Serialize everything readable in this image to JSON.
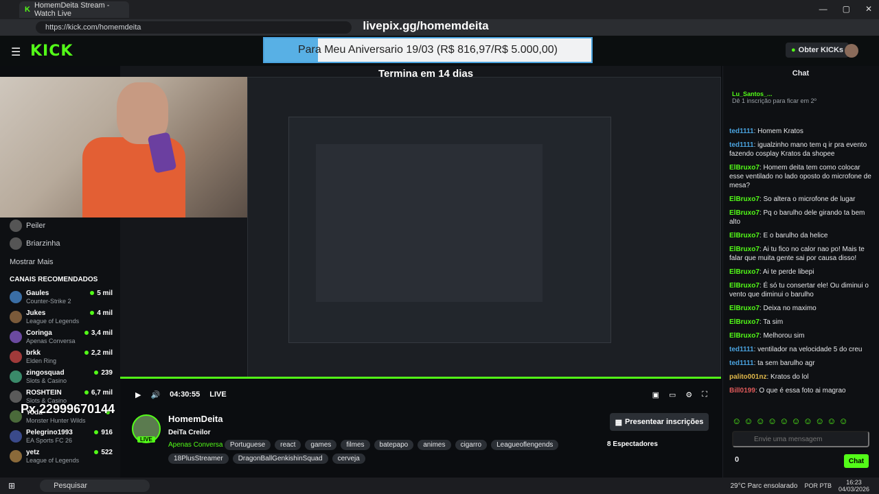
{
  "browser": {
    "tab_title": "HomemDeita Stream - Watch Live",
    "url": "https://kick.com/homemdeita",
    "window_controls": [
      "—",
      "▢",
      "✕"
    ]
  },
  "overlay": {
    "livepix_url": "livepix.gg/homemdeita",
    "goal_text": "Para Meu Aniversario 19/03 (R$ 816,97/R$ 5.000,00)",
    "goal_progress_pct": 16.3,
    "ends_in": "Termina em 14 dias",
    "pix_key": "Px 22999670144"
  },
  "header": {
    "logo": "KICK",
    "kicks_button": "Obter KICKs"
  },
  "sidebar": {
    "users": [
      "Peiler",
      "Briarzinha"
    ],
    "show_more": "Mostrar Mais",
    "recommended_title": "CANAIS RECOMENDADOS",
    "recommended": [
      {
        "name": "Gaules",
        "game": "Counter-Strike 2",
        "viewers": "5 mil",
        "color": "#3a6ea5"
      },
      {
        "name": "Jukes",
        "game": "League of Legends",
        "viewers": "4 mil",
        "color": "#7a5a3a"
      },
      {
        "name": "Coringa",
        "game": "Apenas Conversa",
        "viewers": "3,4 mil",
        "color": "#6b4aa0"
      },
      {
        "name": "brkk",
        "game": "Elden Ring",
        "viewers": "2,2 mil",
        "color": "#a03a3a"
      },
      {
        "name": "zingosquad",
        "game": "Slots & Casino",
        "viewers": "239",
        "color": "#3a8a6a"
      },
      {
        "name": "ROSHTEIN",
        "game": "Slots & Casino",
        "viewers": "6,7 mil",
        "color": "#5a5a5a"
      },
      {
        "name": "Yoda",
        "game": "Monster Hunter Wilds",
        "viewers": "",
        "color": "#4a6a3a"
      },
      {
        "name": "Pelegrino1993",
        "game": "EA Sports FC 26",
        "viewers": "916",
        "color": "#3a4a8a"
      },
      {
        "name": "yetz",
        "game": "League of Legends",
        "viewers": "522",
        "color": "#8a6a3a"
      }
    ]
  },
  "player": {
    "time": "04:30:55",
    "live_label": "LIVE"
  },
  "stream": {
    "streamer": "HomemDeita",
    "live_badge": "LIVE",
    "title": "DeiTa Creilor",
    "category": "Apenas Conversa",
    "tags": [
      "Portuguese",
      "react",
      "games",
      "filmes",
      "batepapo",
      "animes",
      "cigarro",
      "Leagueoflengends"
    ],
    "tags2": [
      "18PlusStreamer",
      "DragonBallGenkishinSquad",
      "cerveja"
    ],
    "subscribe_button": "Presentear inscrições",
    "viewers": "8 Espectadores"
  },
  "chat": {
    "title": "Chat",
    "pinned_user": "Lu_Santos_...",
    "pinned_text": "Dê 1 inscrição para ficar em 2º",
    "messages": [
      {
        "user": "ted1111",
        "text": "Homem Kratos",
        "color": "#4aa3df"
      },
      {
        "user": "ted1111",
        "text": "igualzinho mano tem q ir pra evento fazendo cosplay Kratos da shopee",
        "color": "#4aa3df"
      },
      {
        "user": "ElBruxo7",
        "text": "Homem deita tem como colocar esse ventilado no lado oposto do microfone de mesa?",
        "color": "#53fc18"
      },
      {
        "user": "ElBruxo7",
        "text": "So altera o microfone de lugar",
        "color": "#53fc18"
      },
      {
        "user": "ElBruxo7",
        "text": "Pq o barulho dele girando ta bem alto",
        "color": "#53fc18"
      },
      {
        "user": "ElBruxo7",
        "text": "E o barulho da helice",
        "color": "#53fc18"
      },
      {
        "user": "ElBruxo7",
        "text": "Ai tu fico no calor nao po! Mais te falar que muita gente sai por causa disso!",
        "color": "#53fc18"
      },
      {
        "user": "ElBruxo7",
        "text": "Ai te perde libepi",
        "color": "#53fc18"
      },
      {
        "user": "ElBruxo7",
        "text": "É só tu consertar ele! Ou diminui o vento que diminui o barulho",
        "color": "#53fc18"
      },
      {
        "user": "ElBruxo7",
        "text": "Deixa no maximo",
        "color": "#53fc18"
      },
      {
        "user": "ElBruxo7",
        "text": "Ta sim",
        "color": "#53fc18"
      },
      {
        "user": "ElBruxo7",
        "text": "Melhorou sim",
        "color": "#53fc18"
      },
      {
        "user": "ted1111",
        "text": "ventilador na velocidade 5 do creu",
        "color": "#4aa3df"
      },
      {
        "user": "ted1111",
        "text": "ta sem barulho agr",
        "color": "#4aa3df"
      },
      {
        "user": "palito001nz",
        "text": "Kratos do lol",
        "color": "#e0b84a"
      },
      {
        "user": "Bill0199",
        "text": "O que é essa foto ai magrao",
        "color": "#e05a5a"
      }
    ],
    "input_placeholder": "Envie uma mensagem",
    "kick_count": "0",
    "send_label": "Chat"
  },
  "taskbar": {
    "search_label": "Pesquisar",
    "weather": "29°C  Parc ensolarado",
    "lang": "POR PTB",
    "time": "16:23",
    "date": "04/03/2026"
  }
}
